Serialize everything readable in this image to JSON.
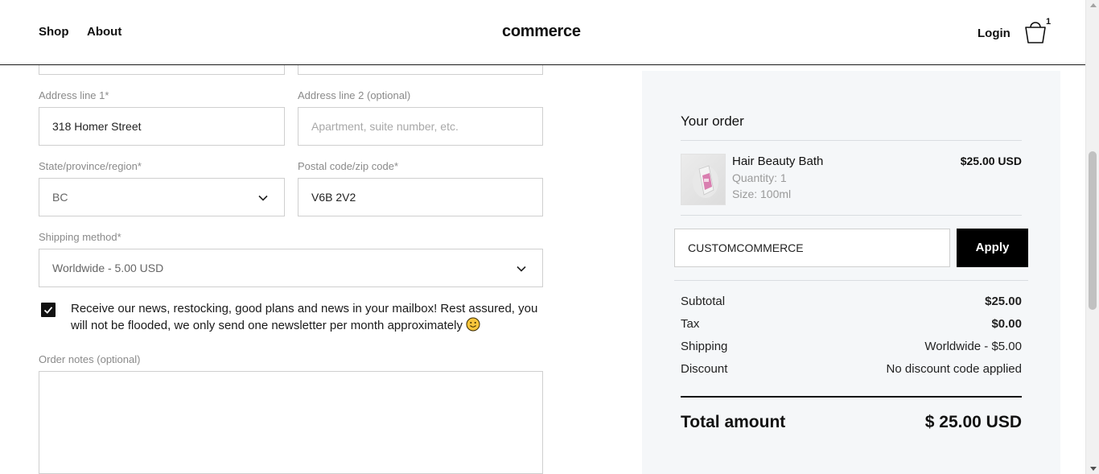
{
  "header": {
    "nav": [
      "Shop",
      "About"
    ],
    "logo": "commerce",
    "login": "Login",
    "cart_count": "1"
  },
  "form": {
    "address1": {
      "label": "Address line 1*",
      "value": "318 Homer Street"
    },
    "address2": {
      "label": "Address line 2 (optional)",
      "placeholder": "Apartment, suite number, etc."
    },
    "state": {
      "label": "State/province/region*",
      "value": "BC"
    },
    "postal": {
      "label": "Postal code/zip code*",
      "value": "V6B 2V2"
    },
    "shipping": {
      "label": "Shipping method*",
      "value": "Worldwide - 5.00 USD"
    },
    "newsletter": {
      "checked": true,
      "text": "Receive our news, restocking, good plans and news in your mailbox! Rest assured, you will not be flooded, we only send one newsletter per month approximately"
    },
    "notes": {
      "label": "Order notes (optional)",
      "value": ""
    }
  },
  "order": {
    "title": "Your order",
    "item": {
      "name": "Hair Beauty Bath",
      "quantity": "Quantity: 1",
      "size": "Size: 100ml",
      "price": "$25.00 USD"
    },
    "coupon": {
      "value": "CUSTOMCOMMERCE",
      "button": "Apply"
    },
    "summary": [
      {
        "label": "Subtotal",
        "value": "$25.00",
        "bold": true
      },
      {
        "label": "Tax",
        "value": "$0.00",
        "bold": true
      },
      {
        "label": "Shipping",
        "value": "Worldwide - $5.00",
        "bold": false
      },
      {
        "label": "Discount",
        "value": "No discount code applied",
        "bold": false
      }
    ],
    "total": {
      "label": "Total amount",
      "value": "$ 25.00 USD"
    }
  },
  "icons": {
    "cart": "shopping-bag-icon",
    "chevron": "chevron-down-icon",
    "check": "checkmark-icon",
    "emoji": "smiley-emoji-icon"
  }
}
